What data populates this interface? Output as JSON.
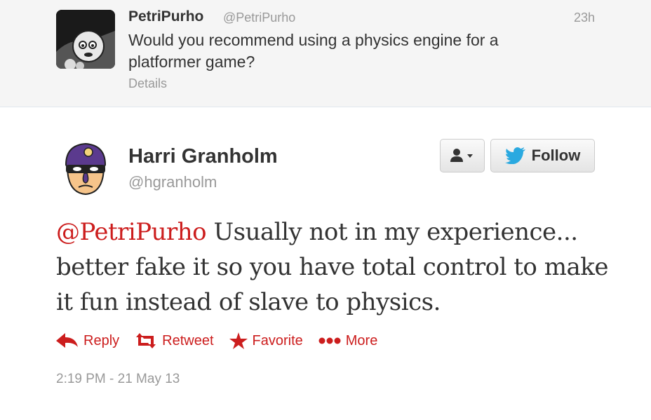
{
  "parent_tweet": {
    "name": "PetriPurho",
    "handle": "@PetriPurho",
    "time": "23h",
    "text": "Would you recommend using a physics engine for a platformer game?",
    "details_label": "Details"
  },
  "main_tweet": {
    "name": "Harri Granholm",
    "handle": "@hgranholm",
    "mention": "@PetriPurho",
    "text": " Usually not in my experience... better fake it so you have total control to make it fun instead of slave to physics.",
    "timestamp": "2:19 PM - 21 May 13"
  },
  "buttons": {
    "user_menu_icon": "user-dropdown-icon",
    "follow_label": "Follow"
  },
  "actions": [
    {
      "label": "Reply",
      "icon": "reply-arrow-icon"
    },
    {
      "label": "Retweet",
      "icon": "retweet-icon"
    },
    {
      "label": "Favorite",
      "icon": "star-icon"
    },
    {
      "label": "More",
      "icon": "ellipsis-icon"
    }
  ],
  "colors": {
    "accent": "#cc1d1d",
    "follow_bird": "#2aa9e0",
    "muted": "#999999"
  }
}
